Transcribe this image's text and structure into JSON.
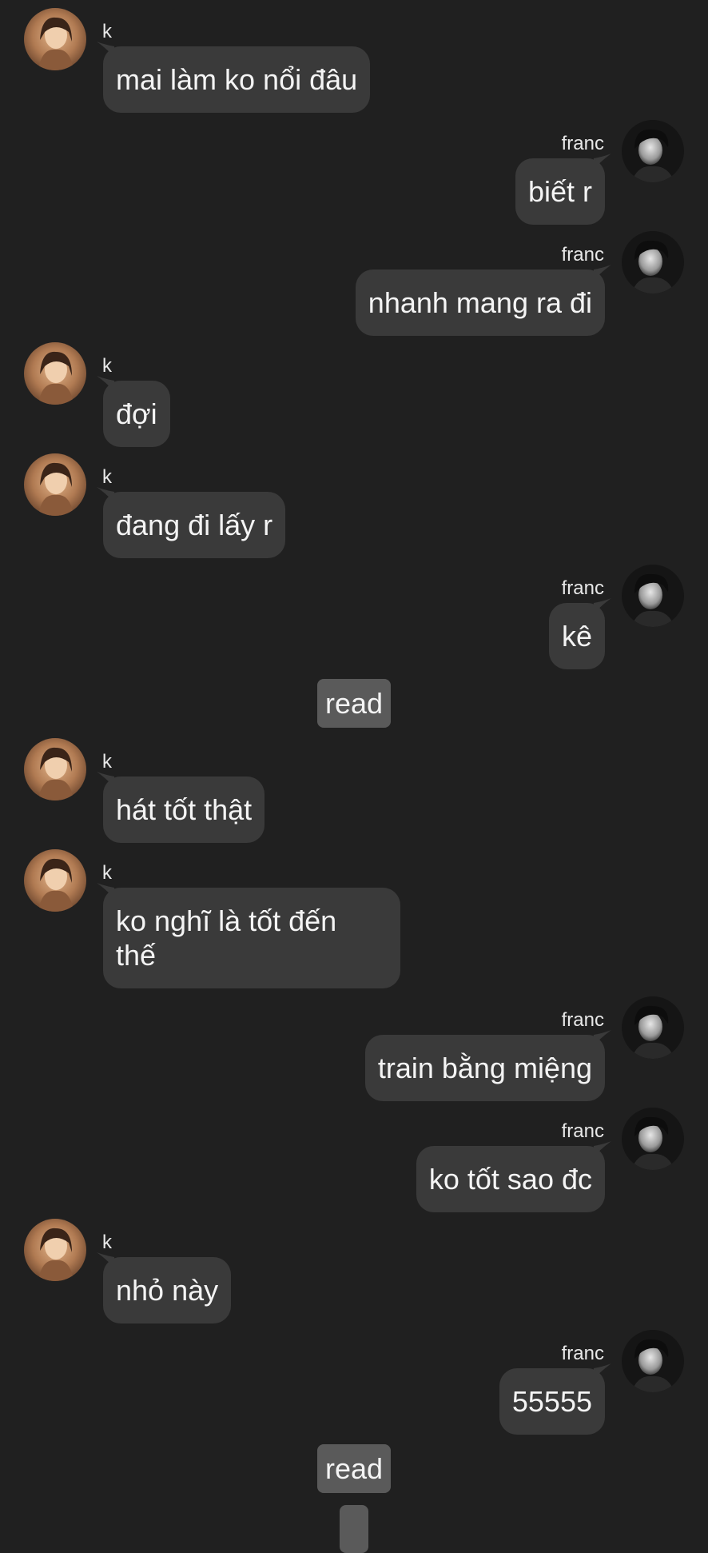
{
  "colors": {
    "background": "#202020",
    "bubble": "#3a3a3a",
    "read_badge": "#5a5a5a",
    "text": "#f4f4f4"
  },
  "contacts": {
    "them": {
      "name": "k",
      "avatar_icon": "user-avatar-icon-k"
    },
    "me": {
      "name": "franc",
      "avatar_icon": "user-avatar-icon-franc"
    }
  },
  "messages": [
    {
      "from": "k",
      "text": "mai làm ko nổi đâu"
    },
    {
      "from": "franc",
      "text": "biết r"
    },
    {
      "from": "franc",
      "text": "nhanh mang ra đi"
    },
    {
      "from": "k",
      "text": "đợi"
    },
    {
      "from": "k",
      "text": "đang đi lấy r"
    },
    {
      "from": "franc",
      "text": "kê"
    },
    {
      "type": "status",
      "text": "read"
    },
    {
      "from": "k",
      "text": "hát tốt thật"
    },
    {
      "from": "k",
      "text": "ko nghĩ là tốt đến\nthế"
    },
    {
      "from": "franc",
      "text": "train bằng miệng"
    },
    {
      "from": "franc",
      "text": "ko tốt sao đc"
    },
    {
      "from": "k",
      "text": "nhỏ này"
    },
    {
      "from": "franc",
      "text": "55555"
    },
    {
      "type": "status",
      "text": "read"
    }
  ]
}
